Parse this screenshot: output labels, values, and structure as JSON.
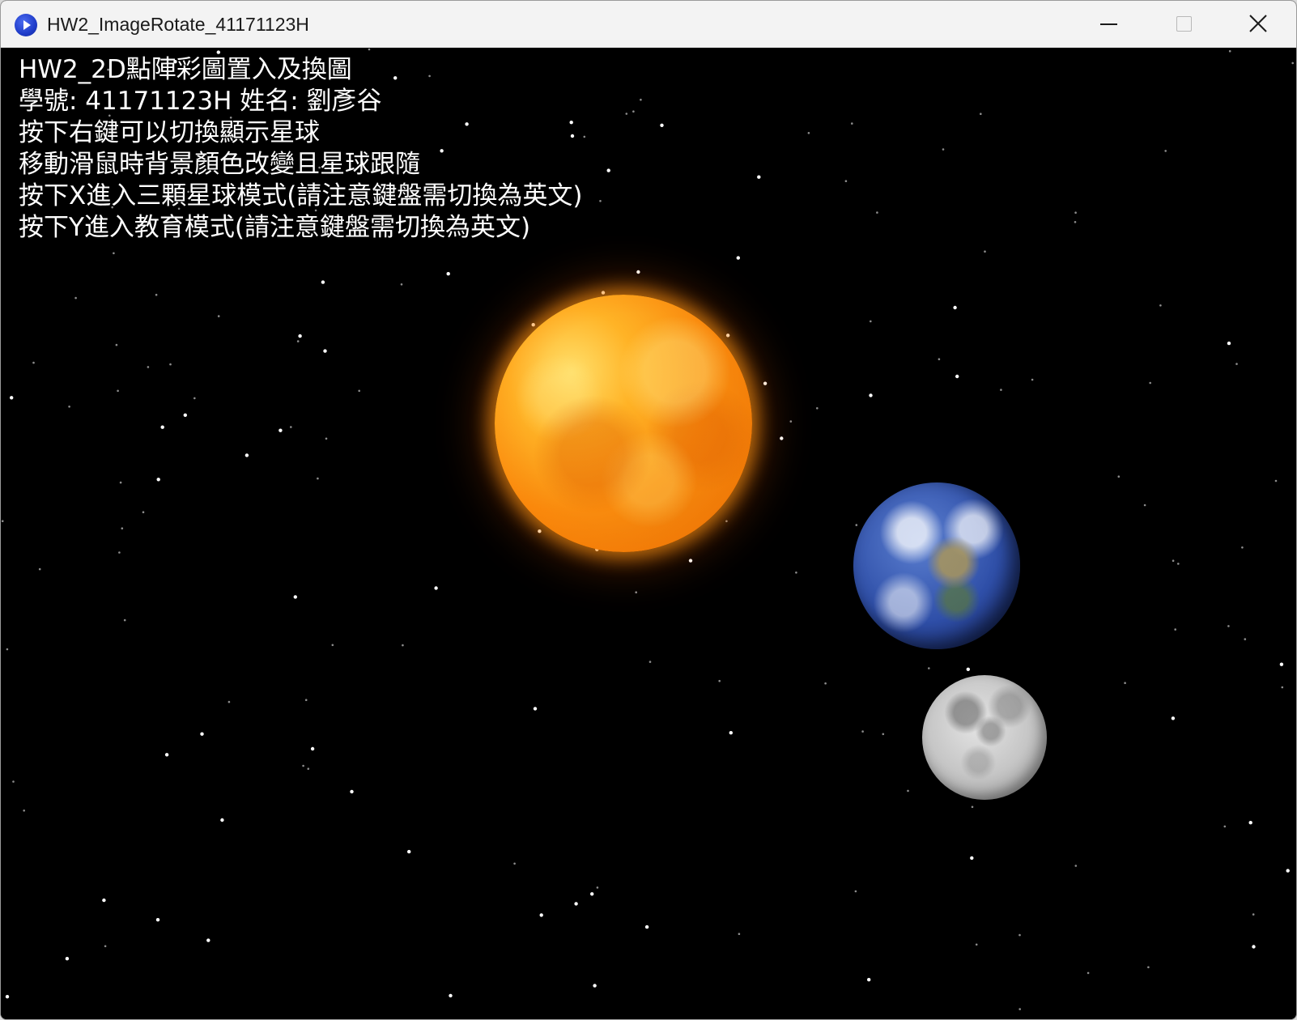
{
  "window": {
    "title": "HW2_ImageRotate_41171123H",
    "app_icon": "play-app-icon"
  },
  "controls": {
    "minimize_icon": "minimize-icon",
    "maximize_icon": "maximize-icon",
    "close_icon": "close-icon"
  },
  "info": {
    "line1": "HW2_2D點陣彩圖置入及換圖",
    "line2": "學號: 41171123H   姓名: 劉彥谷",
    "line3": "按下右鍵可以切換顯示星球",
    "line4": "移動滑鼠時背景顏色改變且星球跟隨",
    "line5": "按下X進入三顆星球模式(請注意鍵盤需切換為英文)",
    "line6": "按下Y進入教育模式(請注意鍵盤需切換為英文)"
  },
  "scene": {
    "background_color": "#000000",
    "text_color": "#ffffff",
    "planets": [
      "sun",
      "earth",
      "moon"
    ]
  }
}
